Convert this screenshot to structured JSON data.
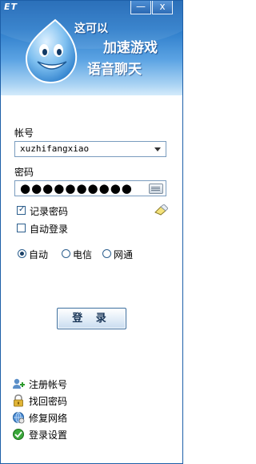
{
  "app": {
    "logo": "ET"
  },
  "window_controls": {
    "minimize": "—",
    "close": "x"
  },
  "banner": {
    "line1": "这可以",
    "line2": "加速游戏",
    "line3": "语音聊天"
  },
  "account": {
    "label": "帐号",
    "value": "xuzhifangxiao"
  },
  "password": {
    "label": "密码",
    "masked": "●●●●●●●●●●"
  },
  "options": {
    "remember": {
      "label": "记录密码",
      "checked": true
    },
    "auto_login": {
      "label": "自动登录",
      "checked": false
    }
  },
  "network": {
    "options": [
      {
        "label": "自动",
        "selected": true
      },
      {
        "label": "电信",
        "selected": false
      },
      {
        "label": "网通",
        "selected": false
      }
    ]
  },
  "login_button": {
    "label": "登 录"
  },
  "links": [
    {
      "label": "注册帐号",
      "icon": "register-icon"
    },
    {
      "label": "找回密码",
      "icon": "lock-icon"
    },
    {
      "label": "修复网络",
      "icon": "network-repair-icon"
    },
    {
      "label": "登录设置",
      "icon": "settings-icon"
    }
  ],
  "colors": {
    "title_blue": "#1a64b4",
    "border": "#1d5fa8",
    "accent_green": "#3aa83a"
  }
}
